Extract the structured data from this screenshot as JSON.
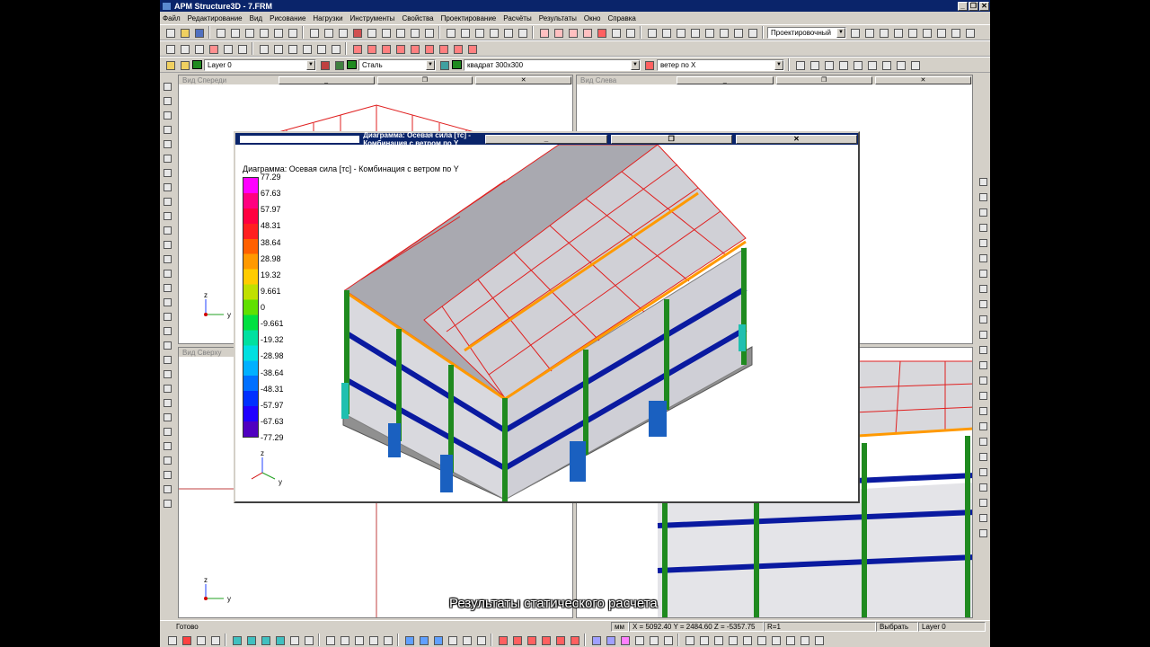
{
  "app": {
    "title": "APM Structure3D - 7.FRM",
    "controls": [
      "_",
      "❐",
      "✕"
    ]
  },
  "menu": [
    "Файл",
    "Редактирование",
    "Вид",
    "Рисование",
    "Нагрузки",
    "Инструменты",
    "Свойства",
    "Проектирование",
    "Расчёты",
    "Результаты",
    "Окно",
    "Справка"
  ],
  "toolbar": {
    "mode_select": "Проектировочный",
    "layer_select": "Layer 0",
    "material_select": "Сталь",
    "section_select": "квадрат 300х300",
    "load_select": "ветер по X"
  },
  "views": {
    "front": {
      "title": "Вид Спереди"
    },
    "left": {
      "title": "Вид Слева"
    },
    "top": {
      "title": "Вид Сверху"
    }
  },
  "axes": {
    "z": "z",
    "y": "y"
  },
  "diagram": {
    "title": "Диаграмма: Осевая сила [тс] - Комбинация с ветром по Y",
    "legend_title": "Диаграмма: Осевая сила [тс] - Комбинация с ветром по Y",
    "legend_values": [
      "77.29",
      "67.63",
      "57.97",
      "48.31",
      "38.64",
      "28.98",
      "19.32",
      "9.661",
      "0",
      "-9.661",
      "-19.32",
      "-28.98",
      "-38.64",
      "-48.31",
      "-57.97",
      "-67.63",
      "-77.29"
    ],
    "legend_colors": [
      "#ff00ff",
      "#ff0080",
      "#ff0040",
      "#ff2020",
      "#ff6000",
      "#ff9900",
      "#ffcc00",
      "#c0e000",
      "#60e000",
      "#00e040",
      "#00e0a0",
      "#00e0e0",
      "#00b0ff",
      "#0070ff",
      "#0030ff",
      "#2000ff",
      "#5000c0"
    ]
  },
  "statusbar": {
    "ready": "Готово",
    "units": "мм",
    "coords": "X = 5092.40 Y = 2484.60 Z = -5357.75",
    "r": "R=1",
    "mode": "Выбрать",
    "layer": "Layer 0"
  },
  "caption": "Результаты статического расчета",
  "colors": {
    "titlebar": "#0a246a",
    "face": "#d4d0c8",
    "steel_green": "#1f8a1f",
    "beam_blue": "#0a1aa0",
    "roof_red": "#e02020",
    "orange": "#ff9900"
  }
}
